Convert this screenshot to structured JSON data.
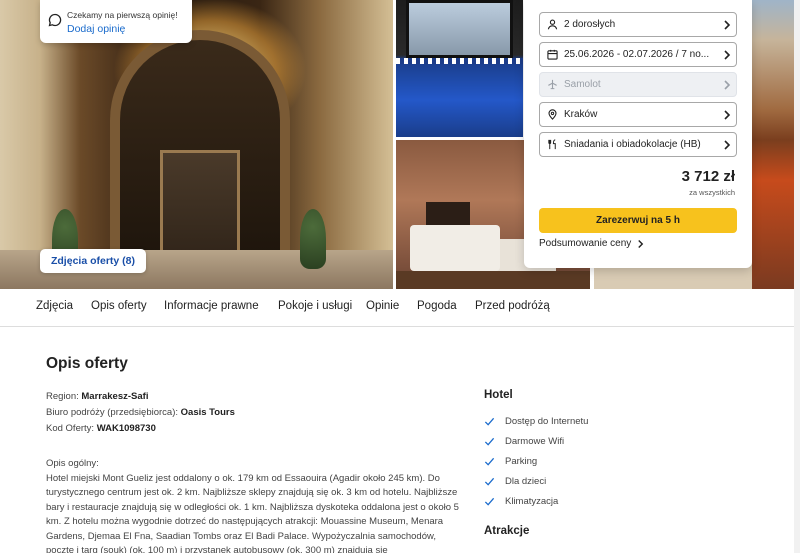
{
  "gallery": {
    "review": {
      "prompt": "Czekamy na pierwszą opinię!",
      "link": "Dodaj opinię"
    },
    "photos_button": "Zdjęcia oferty (8)"
  },
  "booking": {
    "fields": {
      "guests": "2 dorosłych",
      "dates": "25.06.2026 - 02.07.2026 / 7 no...",
      "transport": "Samolot",
      "departure": "Kraków",
      "board": "Śniadania i obiadokolacje (HB)"
    },
    "price": "3 712 zł",
    "price_note": "za wszystkich",
    "book_label": "Zarezerwuj na 5 h",
    "summary_label": "Podsumowanie ceny",
    "accent_color": "#f7c21d"
  },
  "tabs": [
    "Zdjęcia",
    "Opis oferty",
    "Informacje prawne",
    "Pokoje i usługi",
    "Opinie",
    "Pogoda",
    "Przed podróżą"
  ],
  "offer": {
    "title": "Opis oferty",
    "region_label": "Region:",
    "region_value": "Marrakesz-Safi",
    "agency_label": "Biuro podróży (przedsiębiorca):",
    "agency_value": "Oasis Tours",
    "code_label": "Kod Oferty:",
    "code_value": "WAK1098730",
    "general_heading": "Opis ogólny:",
    "general_text": "Hotel miejski Mont Gueliz jest oddalony o ok. 179 km od Essaouira (Agadir około 245 km). Do turystycznego centrum jest ok. 2 km. Najbliższe sklepy znajdują się ok. 3 km od hotelu. Najbliższe bary i restauracje znajdują się w odległości ok. 1 km. Najbliższa dyskoteka oddalona jest o około 5 km. Z hotelu można wygodnie dotrzeć do następujących atrakcji: Mouassine Museum, Menara Gardens, Djemaa El Fna, Saadian Tombs oraz El Badi Palace. Wypożyczalnia samochodów, pocztę i targ (souk) (ok. 100 m) i przystanek autobusowy (ok. 300 m) znajdują się"
  },
  "sidebar": {
    "hotel_heading": "Hotel",
    "hotel_features": [
      "Dostęp do Internetu",
      "Darmowe Wifi",
      "Parking",
      "Dla dzieci",
      "Klimatyzacja"
    ],
    "attractions_heading": "Atrakcje"
  }
}
